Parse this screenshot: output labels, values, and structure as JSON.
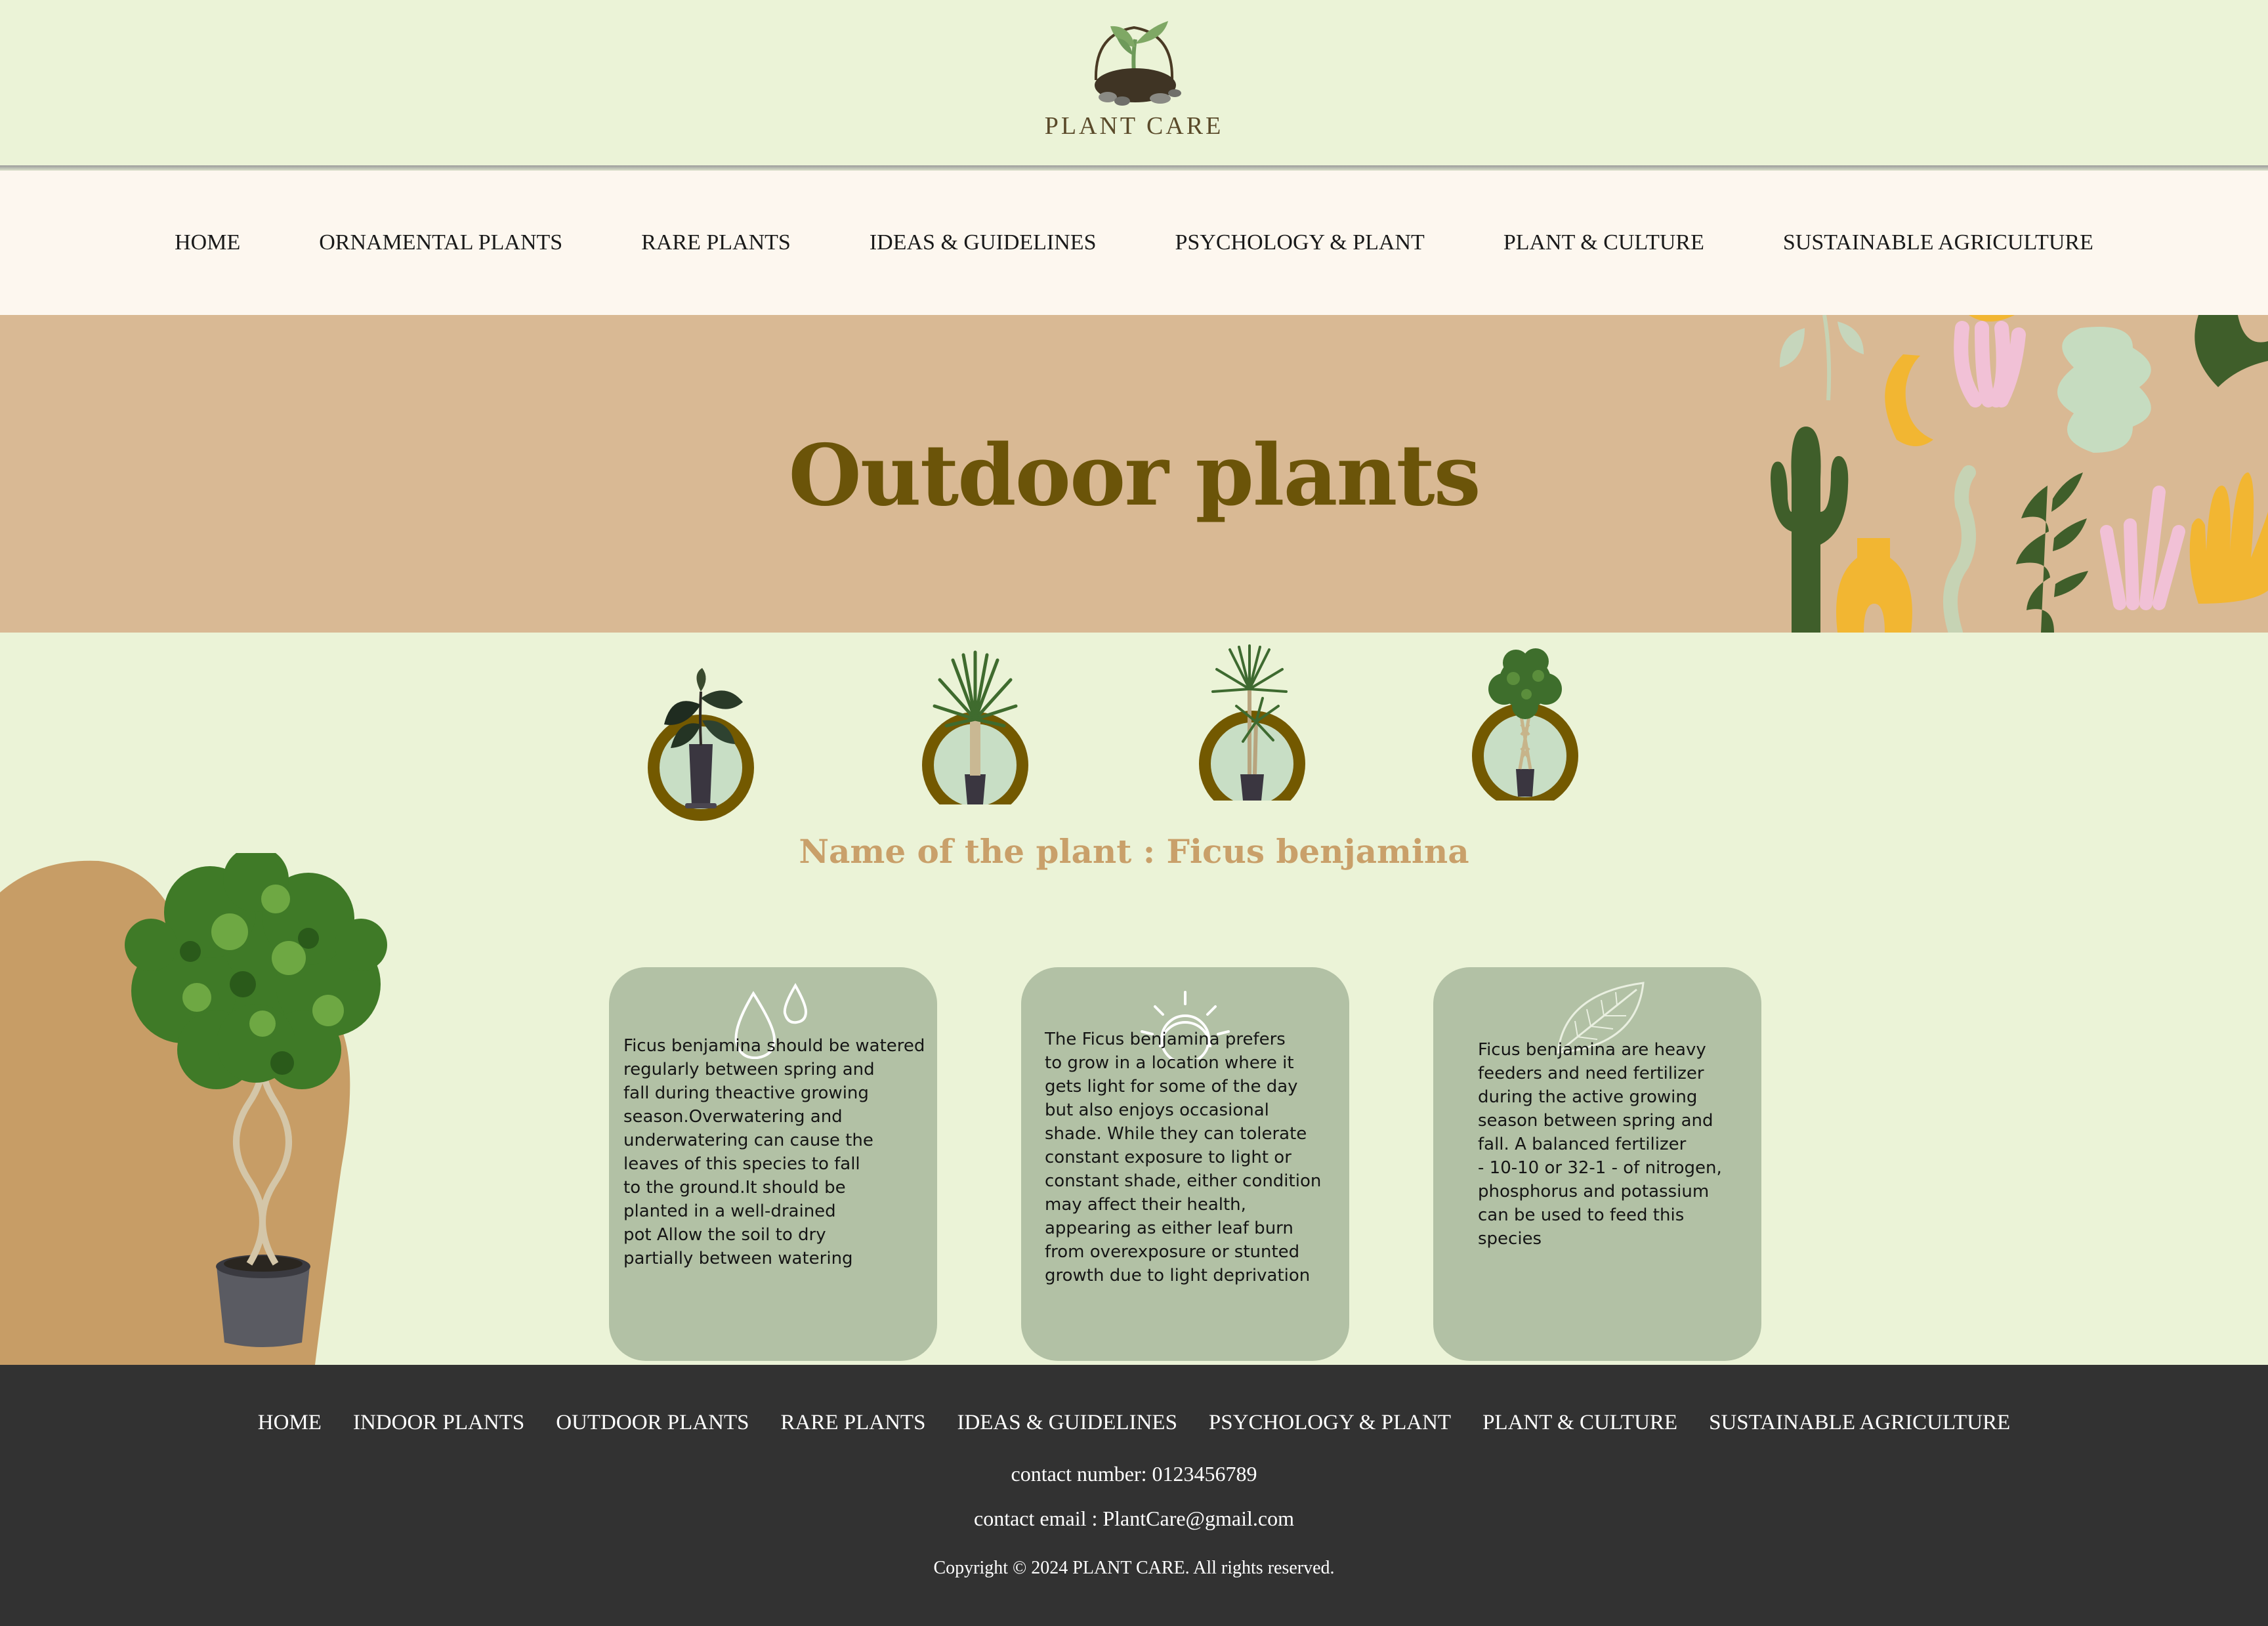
{
  "logo": {
    "text": "PLANT CARE",
    "icon": "sprout-in-soil-icon"
  },
  "nav": {
    "items": [
      {
        "label": "HOME"
      },
      {
        "label": "ORNAMENTAL PLANTS"
      },
      {
        "label": "RARE PLANTS"
      },
      {
        "label": "IDEAS & GUIDELINES"
      },
      {
        "label": "PSYCHOLOGY & PLANT"
      },
      {
        "label": "PLANT & CULTURE"
      },
      {
        "label": "SUSTAINABLE AGRICULTURE"
      }
    ]
  },
  "hero": {
    "title": "Outdoor plants"
  },
  "plants": {
    "thumbnails": [
      {
        "name": "rubber-plant"
      },
      {
        "name": "yucca"
      },
      {
        "name": "dracaena"
      },
      {
        "name": "ficus-benjamina"
      }
    ],
    "selected_label": "Name of the plant : Ficus benjamina"
  },
  "cards": [
    {
      "icon": "water-drops-icon",
      "lines": [
        "Ficus benjamina should be watered",
        "regularly between spring and",
        "fall during theactive growing",
        "season.Overwatering and",
        "underwatering can cause the",
        "leaves of this species to fall",
        "to the ground.It should be",
        "planted in a well-drained",
        "pot Allow the soil to dry",
        "partially between watering"
      ]
    },
    {
      "icon": "sun-icon",
      "lines": [
        "The Ficus benjamina prefers",
        "to grow in a location where it",
        "gets light for some of the day",
        "but also enjoys occasional",
        "shade. While they can tolerate",
        "constant exposure to light or",
        "constant shade, either condition",
        "may affect their health,",
        "appearing as either leaf burn",
        "from overexposure or stunted",
        "growth due to light deprivation"
      ]
    },
    {
      "icon": "leaf-icon",
      "lines": [
        "Ficus benjamina are heavy",
        "feeders and need fertilizer",
        "during the active growing",
        "season between spring and",
        "fall. A balanced fertilizer",
        "- 10-10 or 32-1 - of nitrogen,",
        "phosphorus and potassium",
        "can be used to feed this",
        "species"
      ]
    }
  ],
  "footer": {
    "links": [
      {
        "label": "HOME"
      },
      {
        "label": "INDOOR PLANTS"
      },
      {
        "label": "OUTDOOR PLANTS"
      },
      {
        "label": "RARE PLANTS"
      },
      {
        "label": "IDEAS & GUIDELINES"
      },
      {
        "label": "PSYCHOLOGY & PLANT"
      },
      {
        "label": "PLANT & CULTURE"
      },
      {
        "label": "SUSTAINABLE AGRICULTURE"
      }
    ],
    "contact_number": "contact number: 0123456789",
    "contact_email": "contact email : PlantCare@gmail.com",
    "copyright": "Copyright © 2024 PLANT CARE. All rights reserved."
  },
  "colors": {
    "page_bg": "#ebf3d7",
    "nav_bg": "#fdf7ef",
    "hero_bg": "#d9b994",
    "hero_title": "#6b5409",
    "accent_brown": "#7a5c00",
    "card_bg": "#b2c1a5",
    "footer_bg": "#323232"
  }
}
